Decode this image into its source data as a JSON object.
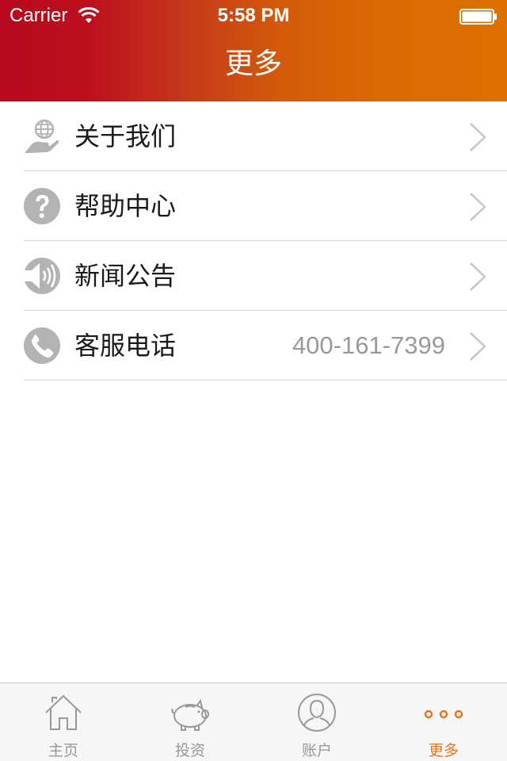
{
  "status_bar": {
    "carrier": "Carrier",
    "time": "5:58 PM"
  },
  "header": {
    "title": "更多"
  },
  "menu": {
    "items": [
      {
        "label": "关于我们",
        "icon": "globe-hand-icon",
        "value": ""
      },
      {
        "label": "帮助中心",
        "icon": "question-icon",
        "value": ""
      },
      {
        "label": "新闻公告",
        "icon": "speaker-icon",
        "value": ""
      },
      {
        "label": "客服电话",
        "icon": "phone-icon",
        "value": "400-161-7399"
      }
    ]
  },
  "tabbar": {
    "tabs": [
      {
        "label": "主页",
        "icon": "home-icon",
        "active": false
      },
      {
        "label": "投资",
        "icon": "piggy-bank-icon",
        "active": false
      },
      {
        "label": "账户",
        "icon": "user-icon",
        "active": false
      },
      {
        "label": "更多",
        "icon": "more-dots-icon",
        "active": true
      }
    ]
  },
  "colors": {
    "header_start": "#b7081e",
    "header_end": "#dc7000",
    "icon_gray": "#b3b3b3",
    "active_tab": "#e8731a",
    "inactive_tab": "#999999"
  }
}
